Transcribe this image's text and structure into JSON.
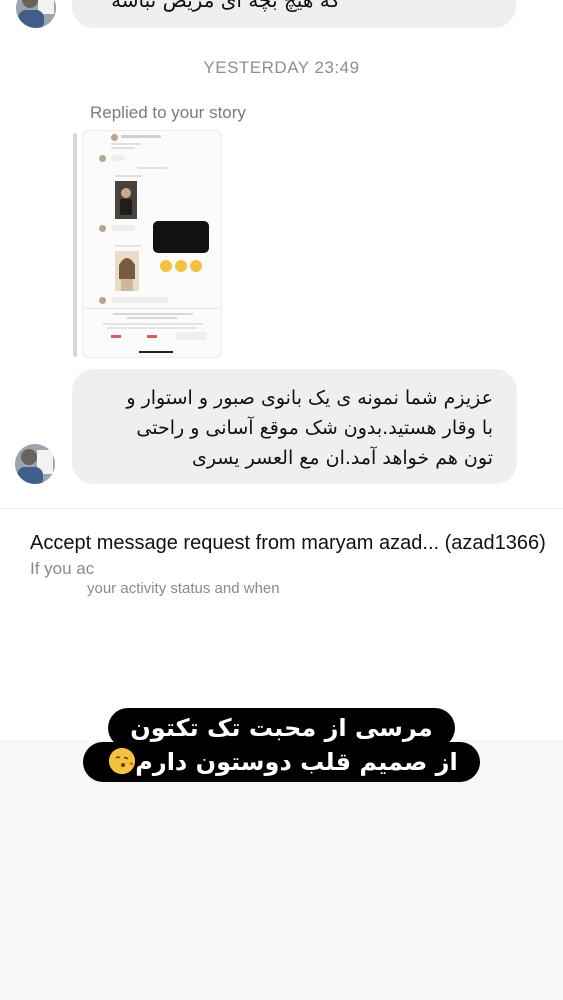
{
  "thread": {
    "top_message": "که هیچ بچه ای مریض نباشه",
    "timestamp": "YESTERDAY 23:49",
    "story_reply_label": "Replied to your story",
    "reply_message_lines": [
      "عزیزم شما نمونه ی یک بانوی صبور و استوار و",
      "با وقار هستید.بدون شک موقع آسانی و راحتی",
      "تون هم خواهد آمد.ان مع العسر یسری"
    ]
  },
  "accept_request": {
    "title": "Accept message request from maryam azad... (azad1366)",
    "body_line1": "If you ac                                                    ... you and see info such a",
    "body_line2": "your activity status and when"
  },
  "caption": {
    "line1": "مرسی از محبت تک تکتون",
    "line2": "از صمیم قلب دوستون دارم"
  },
  "colors": {
    "bubble": "#efeff0",
    "timestamp": "#8e8e93",
    "caption_bg": "#000000",
    "caption_text": "#ffffff"
  },
  "icons": {
    "avatar": "profile-avatar",
    "emoji": "kissing-face-emoji"
  }
}
